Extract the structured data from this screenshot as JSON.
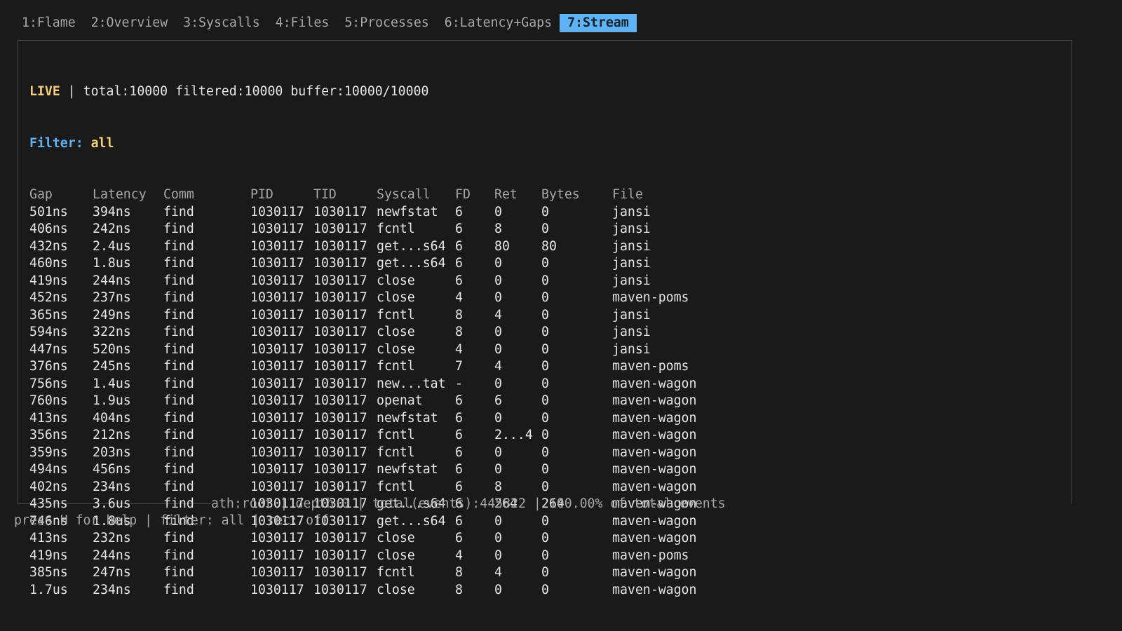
{
  "tabs": [
    {
      "label": "1:Flame",
      "active": false
    },
    {
      "label": "2:Overview",
      "active": false
    },
    {
      "label": "3:Syscalls",
      "active": false
    },
    {
      "label": "4:Files",
      "active": false
    },
    {
      "label": "5:Processes",
      "active": false
    },
    {
      "label": "6:Latency+Gaps",
      "active": false
    },
    {
      "label": "7:Stream",
      "active": true
    }
  ],
  "stream": {
    "live_label": "LIVE",
    "separator": " | ",
    "totals": "total:10000 filtered:10000 buffer:10000/10000",
    "filter_label": "Filter:",
    "filter_value": "all",
    "columns": [
      "Gap",
      "Latency",
      "Comm",
      "PID",
      "TID",
      "Syscall",
      "FD",
      "Ret",
      "Bytes",
      "File"
    ],
    "rows": [
      [
        "501ns",
        "394ns",
        "find",
        "1030117",
        "1030117",
        "newfstat",
        "6",
        "0",
        "0",
        "jansi"
      ],
      [
        "406ns",
        "242ns",
        "find",
        "1030117",
        "1030117",
        "fcntl",
        "6",
        "8",
        "0",
        "jansi"
      ],
      [
        "432ns",
        "2.4us",
        "find",
        "1030117",
        "1030117",
        "get...s64",
        "6",
        "80",
        "80",
        "jansi"
      ],
      [
        "460ns",
        "1.8us",
        "find",
        "1030117",
        "1030117",
        "get...s64",
        "6",
        "0",
        "0",
        "jansi"
      ],
      [
        "419ns",
        "244ns",
        "find",
        "1030117",
        "1030117",
        "close",
        "6",
        "0",
        "0",
        "jansi"
      ],
      [
        "452ns",
        "237ns",
        "find",
        "1030117",
        "1030117",
        "close",
        "4",
        "0",
        "0",
        "maven-poms"
      ],
      [
        "365ns",
        "249ns",
        "find",
        "1030117",
        "1030117",
        "fcntl",
        "8",
        "4",
        "0",
        "jansi"
      ],
      [
        "594ns",
        "322ns",
        "find",
        "1030117",
        "1030117",
        "close",
        "8",
        "0",
        "0",
        "jansi"
      ],
      [
        "447ns",
        "520ns",
        "find",
        "1030117",
        "1030117",
        "close",
        "4",
        "0",
        "0",
        "jansi"
      ],
      [
        "376ns",
        "245ns",
        "find",
        "1030117",
        "1030117",
        "fcntl",
        "7",
        "4",
        "0",
        "maven-poms"
      ],
      [
        "756ns",
        "1.4us",
        "find",
        "1030117",
        "1030117",
        "new...tat",
        "-",
        "0",
        "0",
        "maven-wagon"
      ],
      [
        "760ns",
        "1.9us",
        "find",
        "1030117",
        "1030117",
        "openat",
        "6",
        "6",
        "0",
        "maven-wagon"
      ],
      [
        "413ns",
        "404ns",
        "find",
        "1030117",
        "1030117",
        "newfstat",
        "6",
        "0",
        "0",
        "maven-wagon"
      ],
      [
        "356ns",
        "212ns",
        "find",
        "1030117",
        "1030117",
        "fcntl",
        "6",
        "2...4",
        "0",
        "maven-wagon"
      ],
      [
        "359ns",
        "203ns",
        "find",
        "1030117",
        "1030117",
        "fcntl",
        "6",
        "0",
        "0",
        "maven-wagon"
      ],
      [
        "494ns",
        "456ns",
        "find",
        "1030117",
        "1030117",
        "newfstat",
        "6",
        "0",
        "0",
        "maven-wagon"
      ],
      [
        "402ns",
        "234ns",
        "find",
        "1030117",
        "1030117",
        "fcntl",
        "6",
        "8",
        "0",
        "maven-wagon"
      ],
      [
        "435ns",
        "3.6us",
        "find",
        "1030117",
        "1030117",
        "get...s64",
        "6",
        "264",
        "264",
        "maven-wagon"
      ],
      [
        "746ns",
        "1.8us",
        "find",
        "1030117",
        "1030117",
        "get...s64",
        "6",
        "0",
        "0",
        "maven-wagon"
      ],
      [
        "413ns",
        "232ns",
        "find",
        "1030117",
        "1030117",
        "close",
        "6",
        "0",
        "0",
        "maven-wagon"
      ],
      [
        "419ns",
        "244ns",
        "find",
        "1030117",
        "1030117",
        "close",
        "4",
        "0",
        "0",
        "maven-poms"
      ],
      [
        "385ns",
        "247ns",
        "find",
        "1030117",
        "1030117",
        "fcntl",
        "8",
        "4",
        "0",
        "maven-wagon"
      ],
      [
        "1.7us",
        "234ns",
        "find",
        "1030117",
        "1030117",
        "close",
        "8",
        "0",
        "0",
        "maven-wagon"
      ]
    ]
  },
  "status_line": "ath:root | depth:0 | total(events):445822 | 100.00% of total events",
  "help_line": "press H for help | filter: all | rec: off",
  "colors": {
    "background": "#1a1a1a",
    "active_tab": "#5fb3f5",
    "live": "#f5cf7a",
    "filter_label": "#5fb3f5",
    "muted": "#a8a8a8"
  }
}
